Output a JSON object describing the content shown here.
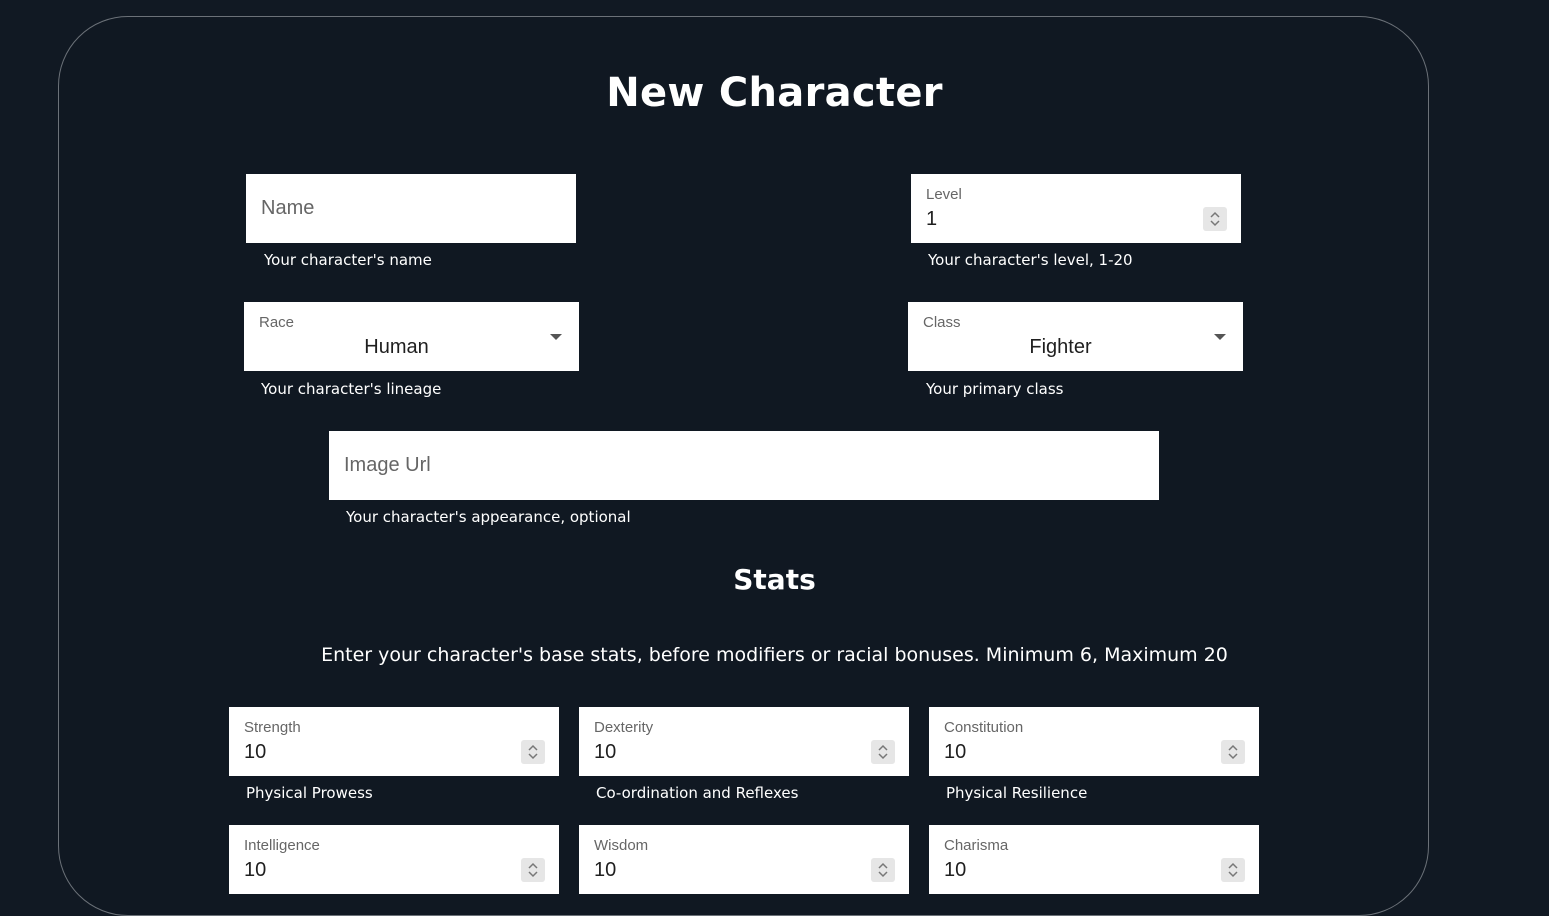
{
  "page": {
    "title": "New Character"
  },
  "name": {
    "placeholder": "Name",
    "helper": "Your character's name"
  },
  "level": {
    "label": "Level",
    "value": "1",
    "helper": "Your character's level, 1-20"
  },
  "race": {
    "label": "Race",
    "value": "Human",
    "helper": "Your character's lineage"
  },
  "class": {
    "label": "Class",
    "value": "Fighter",
    "helper": "Your primary class"
  },
  "image_url": {
    "placeholder": "Image Url",
    "helper": "Your character's appearance, optional"
  },
  "stats": {
    "title": "Stats",
    "description": "Enter your character's base stats, before modifiers or racial bonuses. Minimum 6, Maximum 20",
    "strength": {
      "label": "Strength",
      "value": "10",
      "helper": "Physical Prowess"
    },
    "dexterity": {
      "label": "Dexterity",
      "value": "10",
      "helper": "Co-ordination and Reflexes"
    },
    "constitution": {
      "label": "Constitution",
      "value": "10",
      "helper": "Physical Resilience"
    },
    "intelligence": {
      "label": "Intelligence",
      "value": "10"
    },
    "wisdom": {
      "label": "Wisdom",
      "value": "10"
    },
    "charisma": {
      "label": "Charisma",
      "value": "10"
    }
  }
}
